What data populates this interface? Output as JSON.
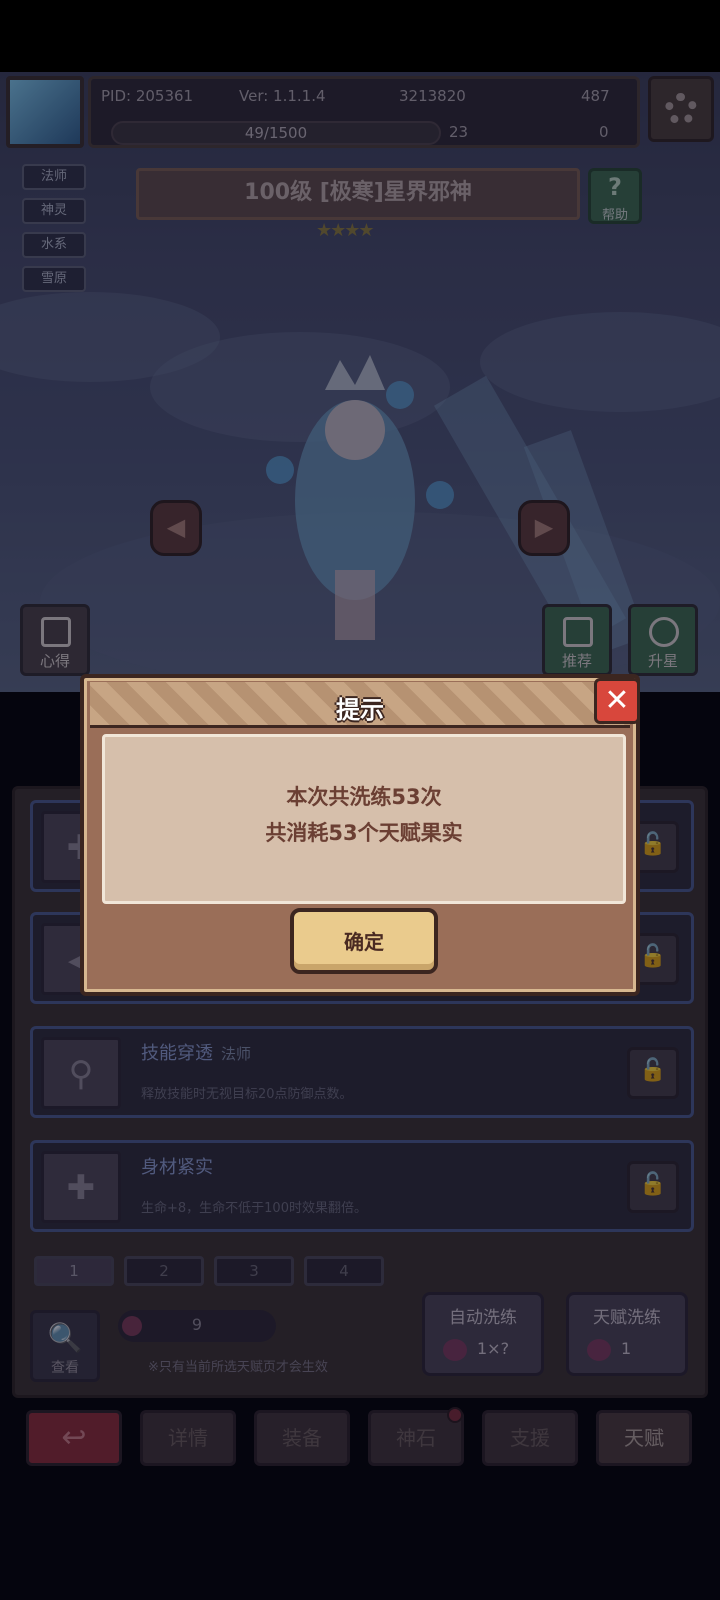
{
  "hud": {
    "pid": "PID: 205361",
    "version": "Ver: 1.1.1.4",
    "gold": "3213820",
    "gems": "487",
    "clover_progress": "49/1500",
    "clover_count": "23",
    "key_count": "0"
  },
  "tags": [
    "法师",
    "神灵",
    "水系",
    "雪原"
  ],
  "hero": {
    "title": "100级 [极寒]星界邪神",
    "stars": "★★★★",
    "help_label": "帮助"
  },
  "side_buttons": {
    "notes": "心得",
    "recommend": "推荐",
    "star_up": "升星"
  },
  "talents": [
    {
      "name": "技能穿透",
      "class": "法师",
      "desc": "释放技能时无视目标20点防御点数。"
    },
    {
      "name": "身材紧实",
      "class": "",
      "desc": "生命+8，生命不低于100时效果翻倍。"
    }
  ],
  "pages": [
    "1",
    "2",
    "3",
    "4"
  ],
  "bottom": {
    "view_label": "查看",
    "fruit_count": "9",
    "note": "※只有当前所选天赋页才会生效",
    "auto_wash_label": "自动洗练",
    "auto_wash_value": "1×?",
    "wash_label": "天赋洗练",
    "wash_value": "1"
  },
  "nav": {
    "back": "↩",
    "items": [
      "详情",
      "装备",
      "神石",
      "支援",
      "天赋"
    ]
  },
  "dialog": {
    "title": "提示",
    "line1": "本次共洗练53次",
    "line2": "共消耗53个天赋果实",
    "ok": "确定",
    "close": "✕"
  }
}
